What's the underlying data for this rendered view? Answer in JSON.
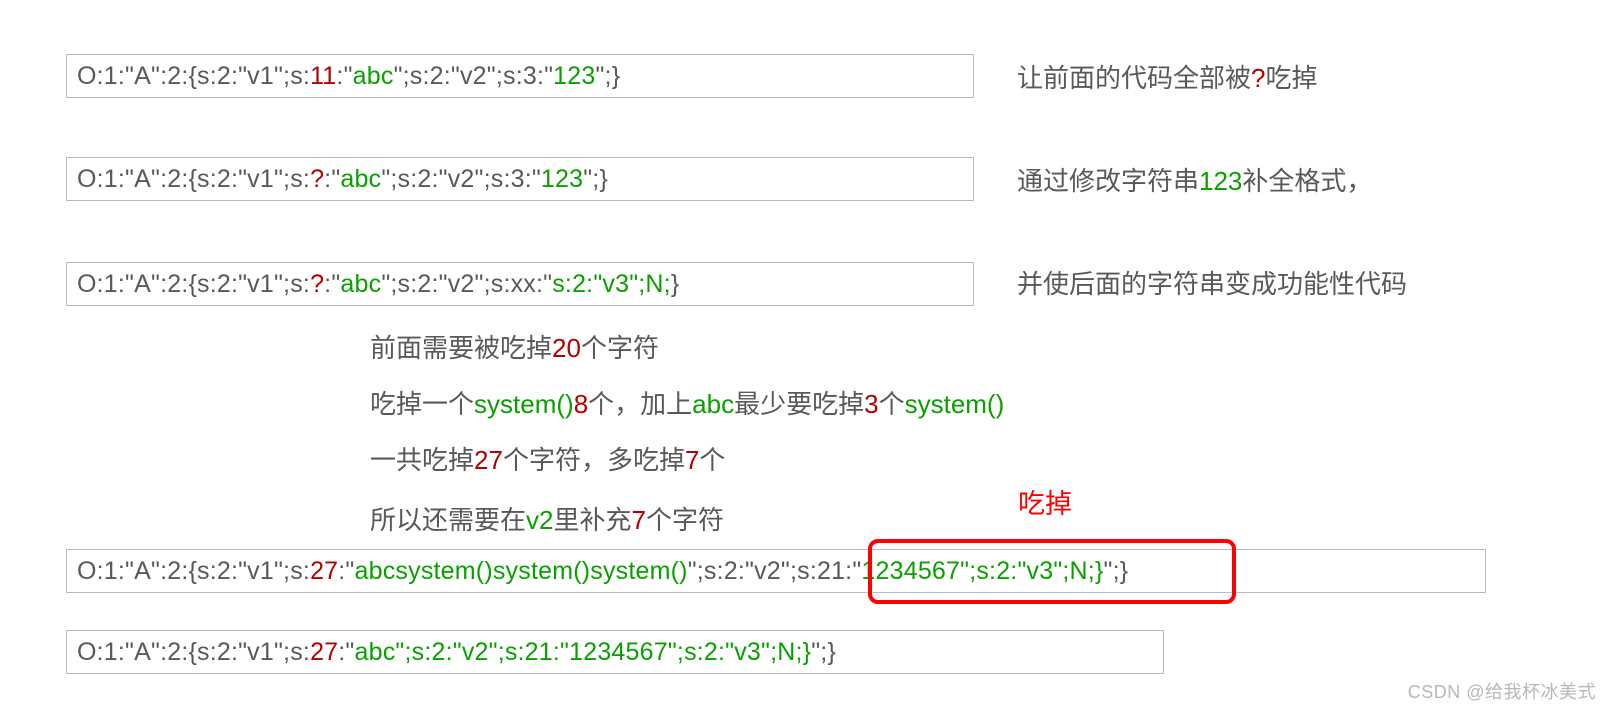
{
  "boxes": {
    "b1": {
      "s": [
        {
          "t": "O:1:\"A\":2:{s:2:\"v1\";s:",
          "c": "grey"
        },
        {
          "t": "11",
          "c": "dred"
        },
        {
          "t": ":\"",
          "c": "grey"
        },
        {
          "t": "abc",
          "c": "green"
        },
        {
          "t": "\";s:2:\"v2\";s:3:\"",
          "c": "grey"
        },
        {
          "t": "123",
          "c": "green"
        },
        {
          "t": "\";}",
          "c": "grey"
        }
      ]
    },
    "b2": {
      "s": [
        {
          "t": "O:1:\"A\":2:{s:2:\"v1\";s:",
          "c": "grey"
        },
        {
          "t": "?",
          "c": "dred"
        },
        {
          "t": ":\"",
          "c": "grey"
        },
        {
          "t": "abc",
          "c": "green"
        },
        {
          "t": "\";s:2:\"v2\";s:3:\"",
          "c": "grey"
        },
        {
          "t": "123",
          "c": "green"
        },
        {
          "t": "\";}",
          "c": "grey"
        }
      ]
    },
    "b3": {
      "s": [
        {
          "t": "O:1:\"A\":2:{s:2:\"v1\";s:",
          "c": "grey"
        },
        {
          "t": "?",
          "c": "dred"
        },
        {
          "t": ":\"",
          "c": "grey"
        },
        {
          "t": "abc",
          "c": "green"
        },
        {
          "t": "\";s:2:\"v2\";s:xx:\"",
          "c": "grey"
        },
        {
          "t": "s:2:\"v3\";N;",
          "c": "green"
        },
        {
          "t": "}",
          "c": "grey"
        }
      ]
    },
    "b4": {
      "s": [
        {
          "t": "O:1:\"A\":2:{s:2:\"v1\";s:",
          "c": "grey"
        },
        {
          "t": "27",
          "c": "dred"
        },
        {
          "t": ":\"",
          "c": "grey"
        },
        {
          "t": "abcsystem()system()system()",
          "c": "green"
        },
        {
          "t": "\";s:2:\"v2\";s:21:\"",
          "c": "grey"
        },
        {
          "t": "1234567",
          "c": "green"
        },
        {
          "t": "\";s:2:\"v3\";N;}",
          "c": "green"
        },
        {
          "t": "\";}",
          "c": "grey"
        }
      ]
    },
    "b5": {
      "s": [
        {
          "t": "O:1:\"A\":2:{s:2:\"v1\";s:",
          "c": "grey"
        },
        {
          "t": "27",
          "c": "dred"
        },
        {
          "t": ":\"",
          "c": "grey"
        },
        {
          "t": "abc\";s:2:\"v2\";s:21:\"1234567",
          "c": "green"
        },
        {
          "t": "\";s:2:\"v3\";N;}",
          "c": "green"
        },
        {
          "t": "\";}",
          "c": "grey"
        }
      ]
    }
  },
  "notes": {
    "n1": [
      {
        "t": "让前面的代码全部被",
        "c": "grey"
      },
      {
        "t": "?",
        "c": "dred"
      },
      {
        "t": "吃掉",
        "c": "grey"
      }
    ],
    "n2": [
      {
        "t": "通过修改字符串",
        "c": "grey"
      },
      {
        "t": "123",
        "c": "green"
      },
      {
        "t": "补全格式，",
        "c": "grey"
      }
    ],
    "n3": [
      {
        "t": "并使后面的字符串变成功能性代码",
        "c": "grey"
      }
    ]
  },
  "aux": {
    "a1": [
      {
        "t": "前面需要被吃掉",
        "c": "grey"
      },
      {
        "t": "20",
        "c": "dred"
      },
      {
        "t": "个字符",
        "c": "grey"
      }
    ],
    "a2": [
      {
        "t": "吃掉一个",
        "c": "grey"
      },
      {
        "t": "system()",
        "c": "green"
      },
      {
        "t": "8",
        "c": "dred"
      },
      {
        "t": "个，加上",
        "c": "grey"
      },
      {
        "t": "abc",
        "c": "green"
      },
      {
        "t": "最少要吃掉",
        "c": "grey"
      },
      {
        "t": "3",
        "c": "dred"
      },
      {
        "t": "个",
        "c": "grey"
      },
      {
        "t": "system()",
        "c": "green"
      }
    ],
    "a3": [
      {
        "t": "一共吃掉",
        "c": "grey"
      },
      {
        "t": "27",
        "c": "dred"
      },
      {
        "t": "个字符，多吃掉",
        "c": "grey"
      },
      {
        "t": "7",
        "c": "dred"
      },
      {
        "t": "个",
        "c": "grey"
      }
    ],
    "a4": [
      {
        "t": "所以还需要在",
        "c": "grey"
      },
      {
        "t": "v2",
        "c": "green"
      },
      {
        "t": "里补充",
        "c": "grey"
      },
      {
        "t": "7",
        "c": "dred"
      },
      {
        "t": "个字符",
        "c": "grey"
      }
    ]
  },
  "redlabel": "吃掉",
  "watermark": "CSDN @给我杯冰美式"
}
